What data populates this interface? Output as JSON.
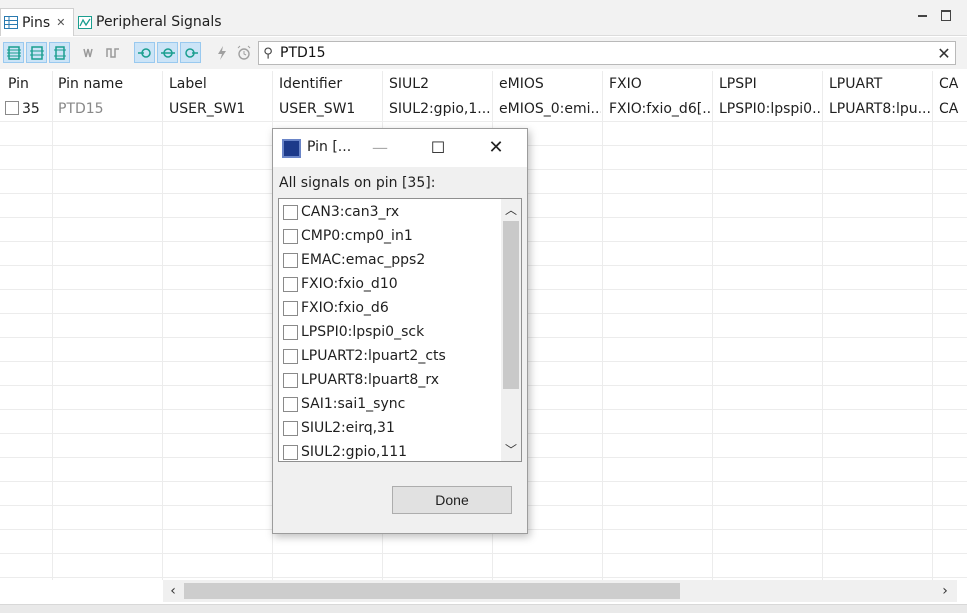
{
  "tabs": [
    {
      "label": "Pins",
      "icon": "table-icon",
      "active": true
    },
    {
      "label": "Peripheral Signals",
      "icon": "waveform-icon",
      "active": false
    }
  ],
  "search": {
    "value": "PTD15"
  },
  "table": {
    "columns": [
      "Pin",
      "Pin name",
      "Label",
      "Identifier",
      "SIUL2",
      "eMIOS",
      "FXIO",
      "LPSPI",
      "LPUART",
      "CA"
    ],
    "rows": [
      [
        "35",
        "PTD15",
        "USER_SW1",
        "USER_SW1",
        "SIUL2:gpio,1...",
        "eMIOS_0:emi...",
        "FXIO:fxio_d6[...",
        "LPSPI0:lpspi0...",
        "LPUART8:lpu...",
        "CA"
      ]
    ]
  },
  "dialog": {
    "title": "Pin [...",
    "label": "All signals on pin [35]:",
    "signals": [
      "CAN3:can3_rx",
      "CMP0:cmp0_in1",
      "EMAC:emac_pps2",
      "FXIO:fxio_d10",
      "FXIO:fxio_d6",
      "LPSPI0:lpspi0_sck",
      "LPUART2:lpuart2_cts",
      "LPUART8:lpuart8_rx",
      "SAI1:sai1_sync",
      "SIUL2:eirq,31",
      "SIUL2:gpio,111"
    ],
    "done_label": "Done"
  },
  "colors": {
    "accent": "#1a9e8f",
    "toggle_bg": "#cce4f7"
  }
}
